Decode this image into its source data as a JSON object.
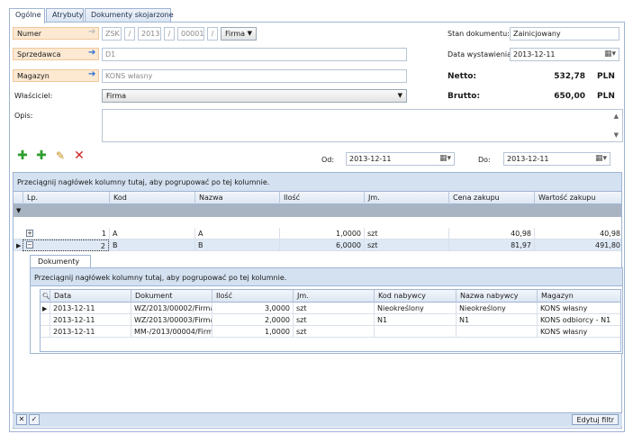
{
  "tabs": [
    "Ogólne",
    "Atrybuty",
    "Dokumenty skojarzone"
  ],
  "form": {
    "numer_label": "Numer",
    "numer_parts": [
      "ZSK",
      "/",
      "2013",
      "/",
      "00001",
      "/"
    ],
    "numer_company": "Firma",
    "sprzedawca_label": "Sprzedawca",
    "sprzedawca_value": "D1",
    "magazyn_label": "Magazyn",
    "magazyn_value": "KONS własny",
    "wlasciciel_label": "Właściciel:",
    "wlasciciel_value": "Firma",
    "opis_label": "Opis:",
    "stan_label": "Stan dokumentu:",
    "stan_value": "Zainicjowany",
    "data_label": "Data wystawienia:",
    "data_value": "2013-12-11",
    "netto_label": "Netto:",
    "netto_value": "532,78",
    "netto_curr": "PLN",
    "brutto_label": "Brutto:",
    "brutto_value": "650,00",
    "brutto_curr": "PLN"
  },
  "range": {
    "od_label": "Od:",
    "od_value": "2013-12-11",
    "do_label": "Do:",
    "do_value": "2013-12-11"
  },
  "grid": {
    "group_hint": "Przeciągnij nagłówek kolumny tutaj, aby pogrupować po tej kolumnie.",
    "headers": [
      "Lp.",
      "Kod",
      "Nazwa",
      "Ilość",
      "Jm.",
      "Cena zakupu",
      "Wartość zakupu"
    ],
    "rows": [
      {
        "lp": "1",
        "kod": "A",
        "nazwa": "A",
        "ilosc": "1,0000",
        "jm": "szt",
        "cena": "40,98",
        "wartosc": "40,98"
      },
      {
        "lp": "2",
        "kod": "B",
        "nazwa": "B",
        "ilosc": "6,0000",
        "jm": "szt",
        "cena": "81,97",
        "wartosc": "491,80"
      }
    ]
  },
  "detail": {
    "tab": "Dokumenty",
    "group_hint": "Przeciągnij nagłówek kolumny tutaj, aby pogrupować po tej kolumnie.",
    "headers": [
      "Data",
      "Dokument",
      "Ilość",
      "Jm.",
      "Kod nabywcy",
      "Nazwa nabywcy",
      "Magazyn"
    ],
    "rows": [
      {
        "data": "2013-12-11",
        "dokument": "WZ/2013/00002/Firma",
        "ilosc": "3,0000",
        "jm": "szt",
        "kod": "Nieokreślony",
        "nazwa": "Nieokreślony",
        "magazyn": "KONS własny"
      },
      {
        "data": "2013-12-11",
        "dokument": "WZ/2013/00003/Firma",
        "ilosc": "2,0000",
        "jm": "szt",
        "kod": "N1",
        "nazwa": "N1",
        "magazyn": "KONS odbiorcy - N1"
      },
      {
        "data": "2013-12-11",
        "dokument": "MM-/2013/00004/Firma",
        "ilosc": "1,0000",
        "jm": "szt",
        "kod": "",
        "nazwa": "",
        "magazyn": "KONS własny"
      }
    ]
  },
  "footer": {
    "edit_filter": "Edytuj filtr"
  }
}
